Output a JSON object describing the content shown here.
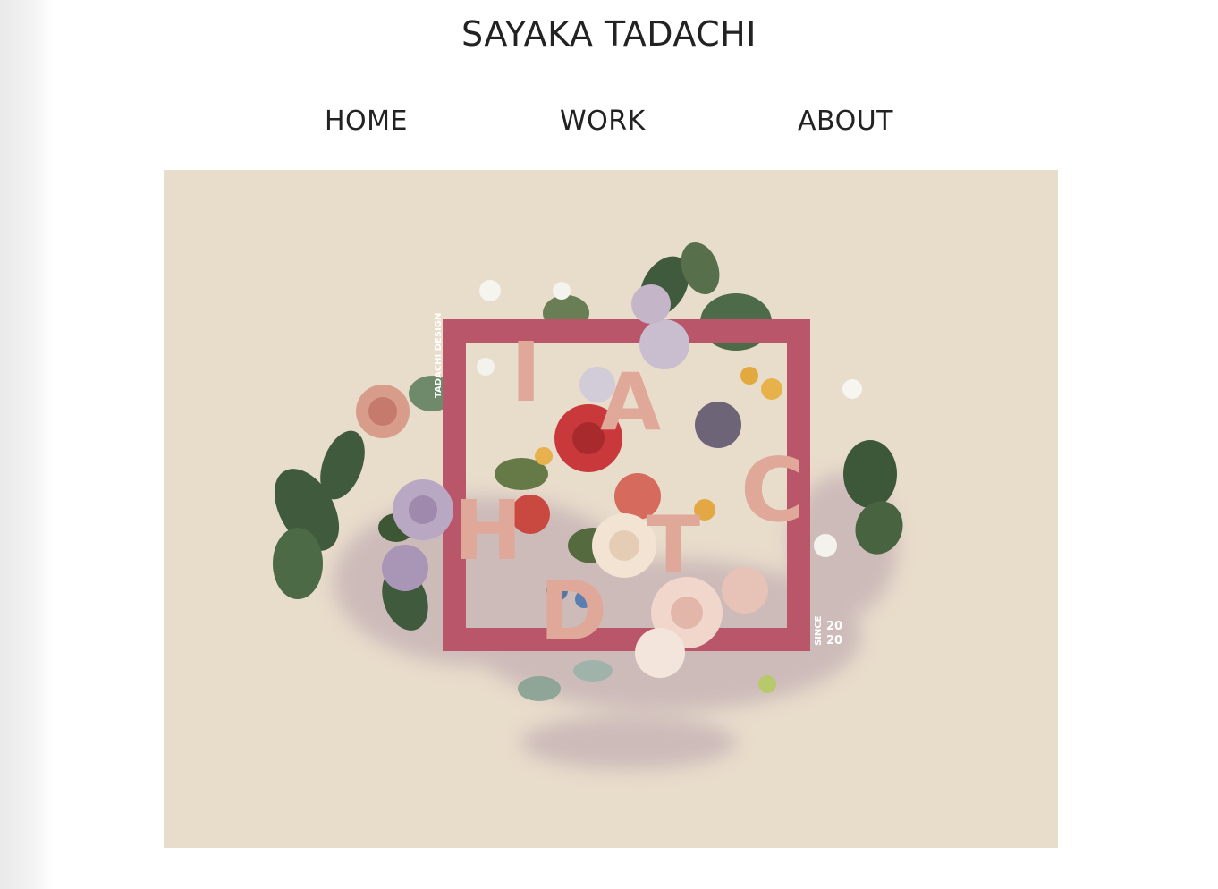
{
  "site": {
    "title": "SAYAKA TADACHI"
  },
  "nav": {
    "items": [
      {
        "label": "HOME"
      },
      {
        "label": "WORK"
      },
      {
        "label": "ABOUT"
      }
    ]
  },
  "hero": {
    "background": "#e8dccb",
    "frame_color": "#b9566a",
    "letter_color": "#dfa898",
    "logo_letters": [
      "I",
      "A",
      "H",
      "C",
      "T",
      "D"
    ],
    "side_text": "TADACHI DESIGN",
    "since_label": "SINCE",
    "since_year_top": "20",
    "since_year_bottom": "20"
  }
}
